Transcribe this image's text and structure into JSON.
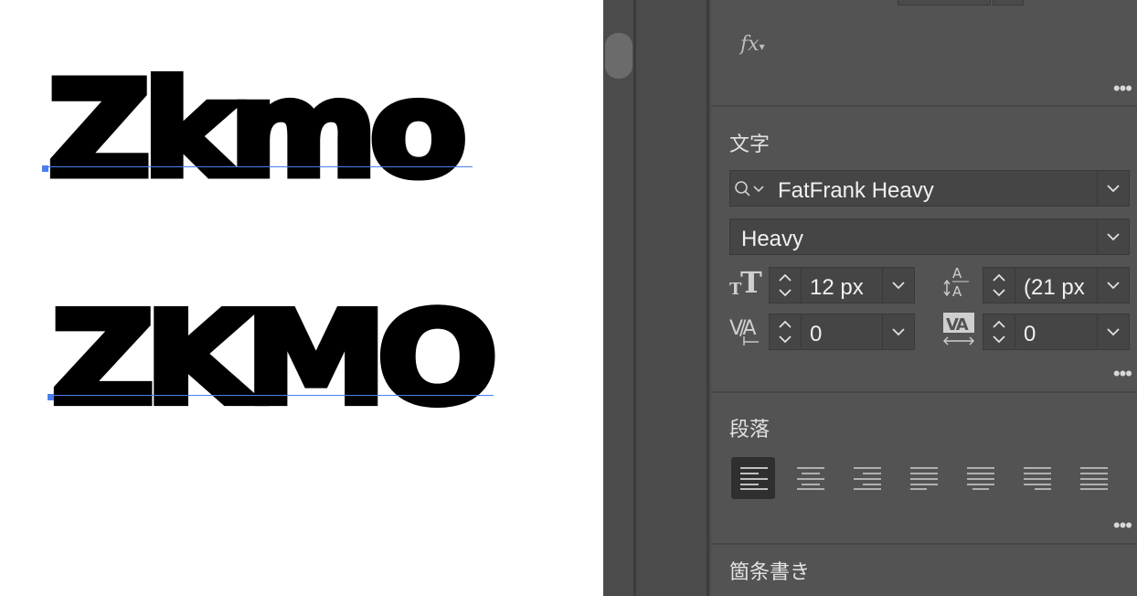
{
  "canvas": {
    "sample_lower": "Zkmo",
    "sample_upper": "ZKMO"
  },
  "panel": {
    "fx_label": "fx",
    "character": {
      "title": "文字",
      "font_family": "FatFrank Heavy",
      "font_style": "Heavy",
      "font_size": "12 px",
      "leading": "(21 px",
      "kerning": "0",
      "tracking": "0"
    },
    "paragraph": {
      "title": "段落",
      "alignments": [
        "align-left",
        "align-center",
        "align-right",
        "justify-left",
        "justify-center",
        "justify-right",
        "justify-all"
      ]
    },
    "bullets": {
      "title": "箇条書き"
    }
  },
  "colors": {
    "panel_bg": "#535353",
    "field_bg": "#454545",
    "baseline_blue": "#4a7ef0"
  }
}
